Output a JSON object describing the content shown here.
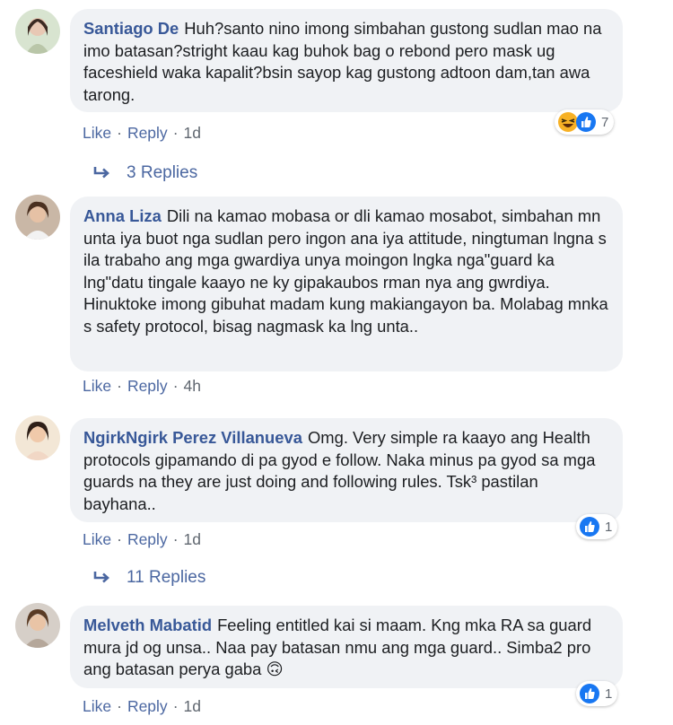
{
  "comments": [
    {
      "author": "Santiago De",
      "text": "Huh?santo nino imong simbahan gustong sudlan mao na imo batasan?stright kaau kag buhok bag o rebond pero mask ug faceshield waka kapalit?bsin sayop kag gustong adtoon dam,tan awa tarong.",
      "like": "Like",
      "reply": "Reply",
      "time": "1d",
      "reaction_count": "7",
      "reaction_icons": [
        "haha-icon",
        "like-icon"
      ],
      "replies": "3 Replies"
    },
    {
      "author": "Anna Liza",
      "text": "Dili na kamao mobasa or dli kamao mosabot, simbahan mn unta iya buot nga sudlan pero ingon ana iya attitude, ningtuman lngna s ila trabaho ang mga gwardiya unya moingon lngka nga\"guard ka lng\"datu tingale kaayo ne ky gipakaubos rman nya ang gwrdiya. Hinuktoke imong gibuhat madam kung makiangayon ba. Molabag mnka s safety protocol, bisag nagmask ka lng unta..",
      "like": "Like",
      "reply": "Reply",
      "time": "4h"
    },
    {
      "author": "NgirkNgirk Perez Villanueva",
      "text": "Omg. Very simple ra kaayo ang Health protocols gipamando di pa gyod e follow. Naka minus pa gyod sa mga guards na they are just doing and following rules. Tsk³ pastilan bayhana..",
      "like": "Like",
      "reply": "Reply",
      "time": "1d",
      "reaction_count": "1",
      "reaction_icons": [
        "like-icon"
      ],
      "replies": "11 Replies"
    },
    {
      "author": "Melveth Mabatid",
      "text": "Feeling entitled kai si maam. Kng mka RA sa guard mura jd og unsa.. Naa pay batasan nmu ang mga guard.. Simba2 pro ang batasan perya gaba 🙃",
      "like": "Like",
      "reply": "Reply",
      "time": "1d",
      "reaction_count": "1",
      "reaction_icons": [
        "like-icon"
      ]
    }
  ],
  "colors": {
    "name": "#385898",
    "link": "#4b67a1",
    "bubble": "#f0f2f5",
    "like": "#1877f2"
  }
}
